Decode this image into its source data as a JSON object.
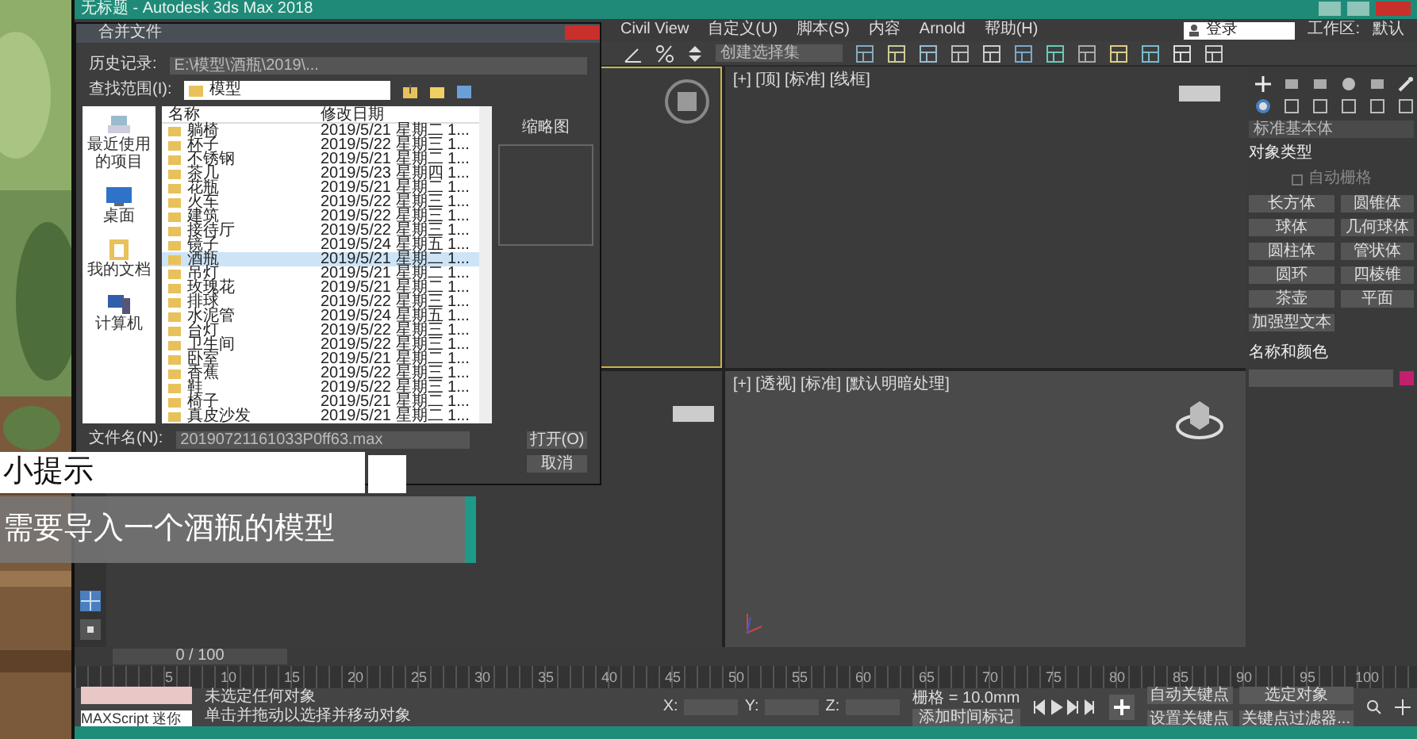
{
  "window": {
    "title": "无标题 - Autodesk 3ds Max 2018"
  },
  "menu": [
    "Civil View",
    "自定义(U)",
    "脚本(S)",
    "内容",
    "Arnold",
    "帮助(H)"
  ],
  "account": {
    "user": "登录",
    "workspace_label": "工作区:",
    "workspace": "默认"
  },
  "toolbar": {
    "selection_set": "创建选择集"
  },
  "viewports": [
    {
      "active": true
    },
    {
      "label": "[+] [顶] [标准] [线框]",
      "active": false
    },
    {
      "active": false
    },
    {
      "label": "[+] [透视] [标准] [默认明暗处理]",
      "active": false
    }
  ],
  "command_panel": {
    "dropdown": "标准基本体",
    "object_type": {
      "title": "对象类型",
      "autogrid": {
        "label": "自动栅格",
        "checked": false
      },
      "buttons": [
        "长方体",
        "圆锥体",
        "球体",
        "几何球体",
        "圆柱体",
        "管状体",
        "圆环",
        "四棱锥",
        "茶壶",
        "平面",
        "加强型文本"
      ]
    },
    "name_color": {
      "title": "名称和颜色"
    }
  },
  "dialog": {
    "title": "合并文件",
    "history_label": "历史记录:",
    "history": "E:\\模型\\酒瓶\\2019\\...",
    "look_in_label": "查找范围(I):",
    "look_in": "模型",
    "places": [
      {
        "label": "最近使用的项目",
        "kind": "recent"
      },
      {
        "label": "桌面",
        "kind": "desktop"
      },
      {
        "label": "我的文档",
        "kind": "documents"
      },
      {
        "label": "计算机",
        "kind": "computer"
      }
    ],
    "columns": [
      "名称",
      "修改日期"
    ],
    "files": [
      {
        "name": "躺椅",
        "date": "2019/5/21 星期二 1...",
        "selected": false
      },
      {
        "name": "杯子",
        "date": "2019/5/22 星期三 1...",
        "selected": false
      },
      {
        "name": "不锈钢",
        "date": "2019/5/21 星期二 1...",
        "selected": false
      },
      {
        "name": "茶几",
        "date": "2019/5/23 星期四 1...",
        "selected": false
      },
      {
        "name": "花瓶",
        "date": "2019/5/21 星期二 1...",
        "selected": false
      },
      {
        "name": "火车",
        "date": "2019/5/22 星期三 1...",
        "selected": false
      },
      {
        "name": "建筑",
        "date": "2019/5/22 星期三 1...",
        "selected": false
      },
      {
        "name": "接待厅",
        "date": "2019/5/22 星期三 1...",
        "selected": false
      },
      {
        "name": "镜子",
        "date": "2019/5/24 星期五 1...",
        "selected": false
      },
      {
        "name": "酒瓶",
        "date": "2019/5/21 星期二 1...",
        "selected": true
      },
      {
        "name": "吊灯",
        "date": "2019/5/21 星期二 1...",
        "selected": false
      },
      {
        "name": "玫瑰花",
        "date": "2019/5/21 星期二 1...",
        "selected": false
      },
      {
        "name": "排球",
        "date": "2019/5/22 星期三 1...",
        "selected": false
      },
      {
        "name": "水泥管",
        "date": "2019/5/24 星期五 1...",
        "selected": false
      },
      {
        "name": "台灯",
        "date": "2019/5/22 星期三 1...",
        "selected": false
      },
      {
        "name": "卫生间",
        "date": "2019/5/22 星期三 1...",
        "selected": false
      },
      {
        "name": "卧室",
        "date": "2019/5/21 星期二 1...",
        "selected": false
      },
      {
        "name": "香蕉",
        "date": "2019/5/22 星期三 1...",
        "selected": false
      },
      {
        "name": "鞋",
        "date": "2019/5/22 星期三 1...",
        "selected": false
      },
      {
        "name": "椅子",
        "date": "2019/5/21 星期二 1...",
        "selected": false
      },
      {
        "name": "真皮沙发",
        "date": "2019/5/21 星期二 1...",
        "selected": false
      }
    ],
    "preview_label": "缩略图",
    "filename_label": "文件名(N):",
    "filename": "20190721161033P0ff63.max",
    "buttons": [
      "打开(O)",
      "取消"
    ]
  },
  "tip": {
    "title": "小提示",
    "text": "需要导入一个酒瓶的模型"
  },
  "timeline": {
    "frame": "0 / 100",
    "level": 0,
    "ticks": [
      "5",
      "10",
      "15",
      "20",
      "25",
      "30",
      "35",
      "40",
      "45",
      "50",
      "55",
      "60",
      "65",
      "70",
      "75",
      "80",
      "85",
      "90",
      "95",
      "100"
    ]
  },
  "status": {
    "maxscript": "MAXScript 迷你",
    "message": "未选定任何对象",
    "hint": "单击并拖动以选择并移动对象",
    "coords": [
      "X:",
      "Y:",
      "Z:"
    ],
    "grid": "栅格 = 10.0mm",
    "add_time_tag": "添加时间标记",
    "auto_key": "自动关键点",
    "key_mode": "选定对象",
    "set_key": "设置关键点",
    "key_filters": "关键点过滤器..."
  }
}
